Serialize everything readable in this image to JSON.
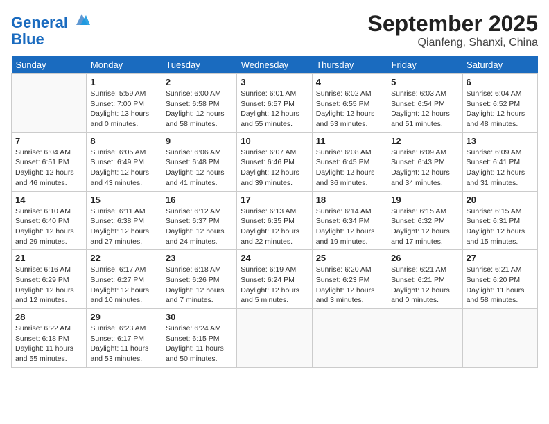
{
  "header": {
    "logo_line1": "General",
    "logo_line2": "Blue",
    "month": "September 2025",
    "location": "Qianfeng, Shanxi, China"
  },
  "weekdays": [
    "Sunday",
    "Monday",
    "Tuesday",
    "Wednesday",
    "Thursday",
    "Friday",
    "Saturday"
  ],
  "weeks": [
    [
      {
        "day": "",
        "info": ""
      },
      {
        "day": "1",
        "info": "Sunrise: 5:59 AM\nSunset: 7:00 PM\nDaylight: 13 hours\nand 0 minutes."
      },
      {
        "day": "2",
        "info": "Sunrise: 6:00 AM\nSunset: 6:58 PM\nDaylight: 12 hours\nand 58 minutes."
      },
      {
        "day": "3",
        "info": "Sunrise: 6:01 AM\nSunset: 6:57 PM\nDaylight: 12 hours\nand 55 minutes."
      },
      {
        "day": "4",
        "info": "Sunrise: 6:02 AM\nSunset: 6:55 PM\nDaylight: 12 hours\nand 53 minutes."
      },
      {
        "day": "5",
        "info": "Sunrise: 6:03 AM\nSunset: 6:54 PM\nDaylight: 12 hours\nand 51 minutes."
      },
      {
        "day": "6",
        "info": "Sunrise: 6:04 AM\nSunset: 6:52 PM\nDaylight: 12 hours\nand 48 minutes."
      }
    ],
    [
      {
        "day": "7",
        "info": "Sunrise: 6:04 AM\nSunset: 6:51 PM\nDaylight: 12 hours\nand 46 minutes."
      },
      {
        "day": "8",
        "info": "Sunrise: 6:05 AM\nSunset: 6:49 PM\nDaylight: 12 hours\nand 43 minutes."
      },
      {
        "day": "9",
        "info": "Sunrise: 6:06 AM\nSunset: 6:48 PM\nDaylight: 12 hours\nand 41 minutes."
      },
      {
        "day": "10",
        "info": "Sunrise: 6:07 AM\nSunset: 6:46 PM\nDaylight: 12 hours\nand 39 minutes."
      },
      {
        "day": "11",
        "info": "Sunrise: 6:08 AM\nSunset: 6:45 PM\nDaylight: 12 hours\nand 36 minutes."
      },
      {
        "day": "12",
        "info": "Sunrise: 6:09 AM\nSunset: 6:43 PM\nDaylight: 12 hours\nand 34 minutes."
      },
      {
        "day": "13",
        "info": "Sunrise: 6:09 AM\nSunset: 6:41 PM\nDaylight: 12 hours\nand 31 minutes."
      }
    ],
    [
      {
        "day": "14",
        "info": "Sunrise: 6:10 AM\nSunset: 6:40 PM\nDaylight: 12 hours\nand 29 minutes."
      },
      {
        "day": "15",
        "info": "Sunrise: 6:11 AM\nSunset: 6:38 PM\nDaylight: 12 hours\nand 27 minutes."
      },
      {
        "day": "16",
        "info": "Sunrise: 6:12 AM\nSunset: 6:37 PM\nDaylight: 12 hours\nand 24 minutes."
      },
      {
        "day": "17",
        "info": "Sunrise: 6:13 AM\nSunset: 6:35 PM\nDaylight: 12 hours\nand 22 minutes."
      },
      {
        "day": "18",
        "info": "Sunrise: 6:14 AM\nSunset: 6:34 PM\nDaylight: 12 hours\nand 19 minutes."
      },
      {
        "day": "19",
        "info": "Sunrise: 6:15 AM\nSunset: 6:32 PM\nDaylight: 12 hours\nand 17 minutes."
      },
      {
        "day": "20",
        "info": "Sunrise: 6:15 AM\nSunset: 6:31 PM\nDaylight: 12 hours\nand 15 minutes."
      }
    ],
    [
      {
        "day": "21",
        "info": "Sunrise: 6:16 AM\nSunset: 6:29 PM\nDaylight: 12 hours\nand 12 minutes."
      },
      {
        "day": "22",
        "info": "Sunrise: 6:17 AM\nSunset: 6:27 PM\nDaylight: 12 hours\nand 10 minutes."
      },
      {
        "day": "23",
        "info": "Sunrise: 6:18 AM\nSunset: 6:26 PM\nDaylight: 12 hours\nand 7 minutes."
      },
      {
        "day": "24",
        "info": "Sunrise: 6:19 AM\nSunset: 6:24 PM\nDaylight: 12 hours\nand 5 minutes."
      },
      {
        "day": "25",
        "info": "Sunrise: 6:20 AM\nSunset: 6:23 PM\nDaylight: 12 hours\nand 3 minutes."
      },
      {
        "day": "26",
        "info": "Sunrise: 6:21 AM\nSunset: 6:21 PM\nDaylight: 12 hours\nand 0 minutes."
      },
      {
        "day": "27",
        "info": "Sunrise: 6:21 AM\nSunset: 6:20 PM\nDaylight: 11 hours\nand 58 minutes."
      }
    ],
    [
      {
        "day": "28",
        "info": "Sunrise: 6:22 AM\nSunset: 6:18 PM\nDaylight: 11 hours\nand 55 minutes."
      },
      {
        "day": "29",
        "info": "Sunrise: 6:23 AM\nSunset: 6:17 PM\nDaylight: 11 hours\nand 53 minutes."
      },
      {
        "day": "30",
        "info": "Sunrise: 6:24 AM\nSunset: 6:15 PM\nDaylight: 11 hours\nand 50 minutes."
      },
      {
        "day": "",
        "info": ""
      },
      {
        "day": "",
        "info": ""
      },
      {
        "day": "",
        "info": ""
      },
      {
        "day": "",
        "info": ""
      }
    ]
  ]
}
